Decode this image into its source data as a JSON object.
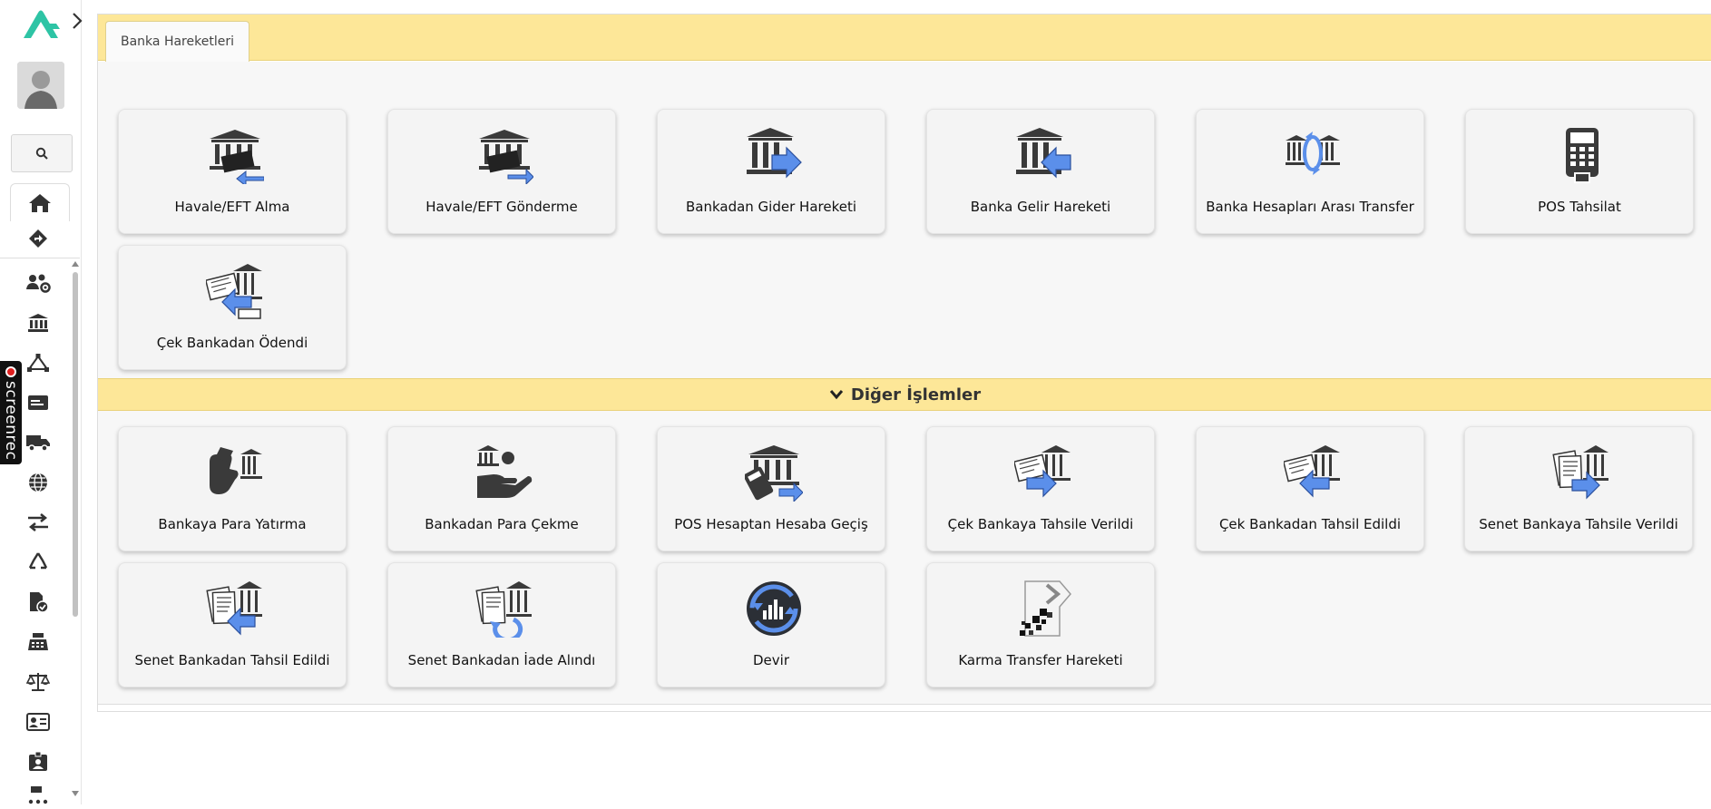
{
  "sidebar": {
    "nav_icons": [
      "users-gear-icon",
      "bank-icon",
      "network-icon",
      "card-icon",
      "truck-icon",
      "globe-icon",
      "transfer-arrows-icon",
      "recycle-icon",
      "document-check-icon",
      "cash-register-icon",
      "scale-icon",
      "id-card-icon",
      "badge-icon",
      "more-icon"
    ],
    "screenrec_label": "screenrec"
  },
  "tabs": [
    {
      "label": "Banka Hareketleri"
    }
  ],
  "main_cards": [
    {
      "label": "Havale/EFT Alma",
      "icon": "bank-money-in-icon"
    },
    {
      "label": "Havale/EFT Gönderme",
      "icon": "bank-money-out-icon"
    },
    {
      "label": "Bankadan Gider Hareketi",
      "icon": "bank-arrow-right-icon"
    },
    {
      "label": "Banka Gelir Hareketi",
      "icon": "bank-arrow-left-icon"
    },
    {
      "label": "Banka Hesapları Arası Transfer",
      "icon": "bank-transfer-icon"
    },
    {
      "label": "POS Tahsilat",
      "icon": "pos-terminal-icon"
    },
    {
      "label": "Çek Bankadan Ödendi",
      "icon": "check-bank-paid-icon"
    }
  ],
  "section": {
    "title": "Diğer İşlemler"
  },
  "other_cards": [
    {
      "label": "Bankaya Para Yatırma",
      "icon": "deposit-icon"
    },
    {
      "label": "Bankadan Para Çekme",
      "icon": "withdraw-icon"
    },
    {
      "label": "POS Hesaptan Hesaba Geçiş",
      "icon": "pos-account-transfer-icon"
    },
    {
      "label": "Çek Bankaya Tahsile Verildi",
      "icon": "check-to-bank-icon"
    },
    {
      "label": "Çek Bankadan Tahsil Edildi",
      "icon": "check-from-bank-icon"
    },
    {
      "label": "Senet Bankaya Tahsile Verildi",
      "icon": "note-to-bank-icon"
    },
    {
      "label": "Senet Bankadan Tahsil Edildi",
      "icon": "note-from-bank-icon"
    },
    {
      "label": "Senet Bankadan İade Alındı",
      "icon": "note-return-icon"
    },
    {
      "label": "Devir",
      "icon": "carry-over-icon"
    },
    {
      "label": "Karma Transfer Hareketi",
      "icon": "mixed-transfer-icon"
    }
  ],
  "colors": {
    "accent_yellow": "#fde798",
    "arrow_blue": "#5b8fea",
    "icon_dark": "#3a3a3a"
  }
}
